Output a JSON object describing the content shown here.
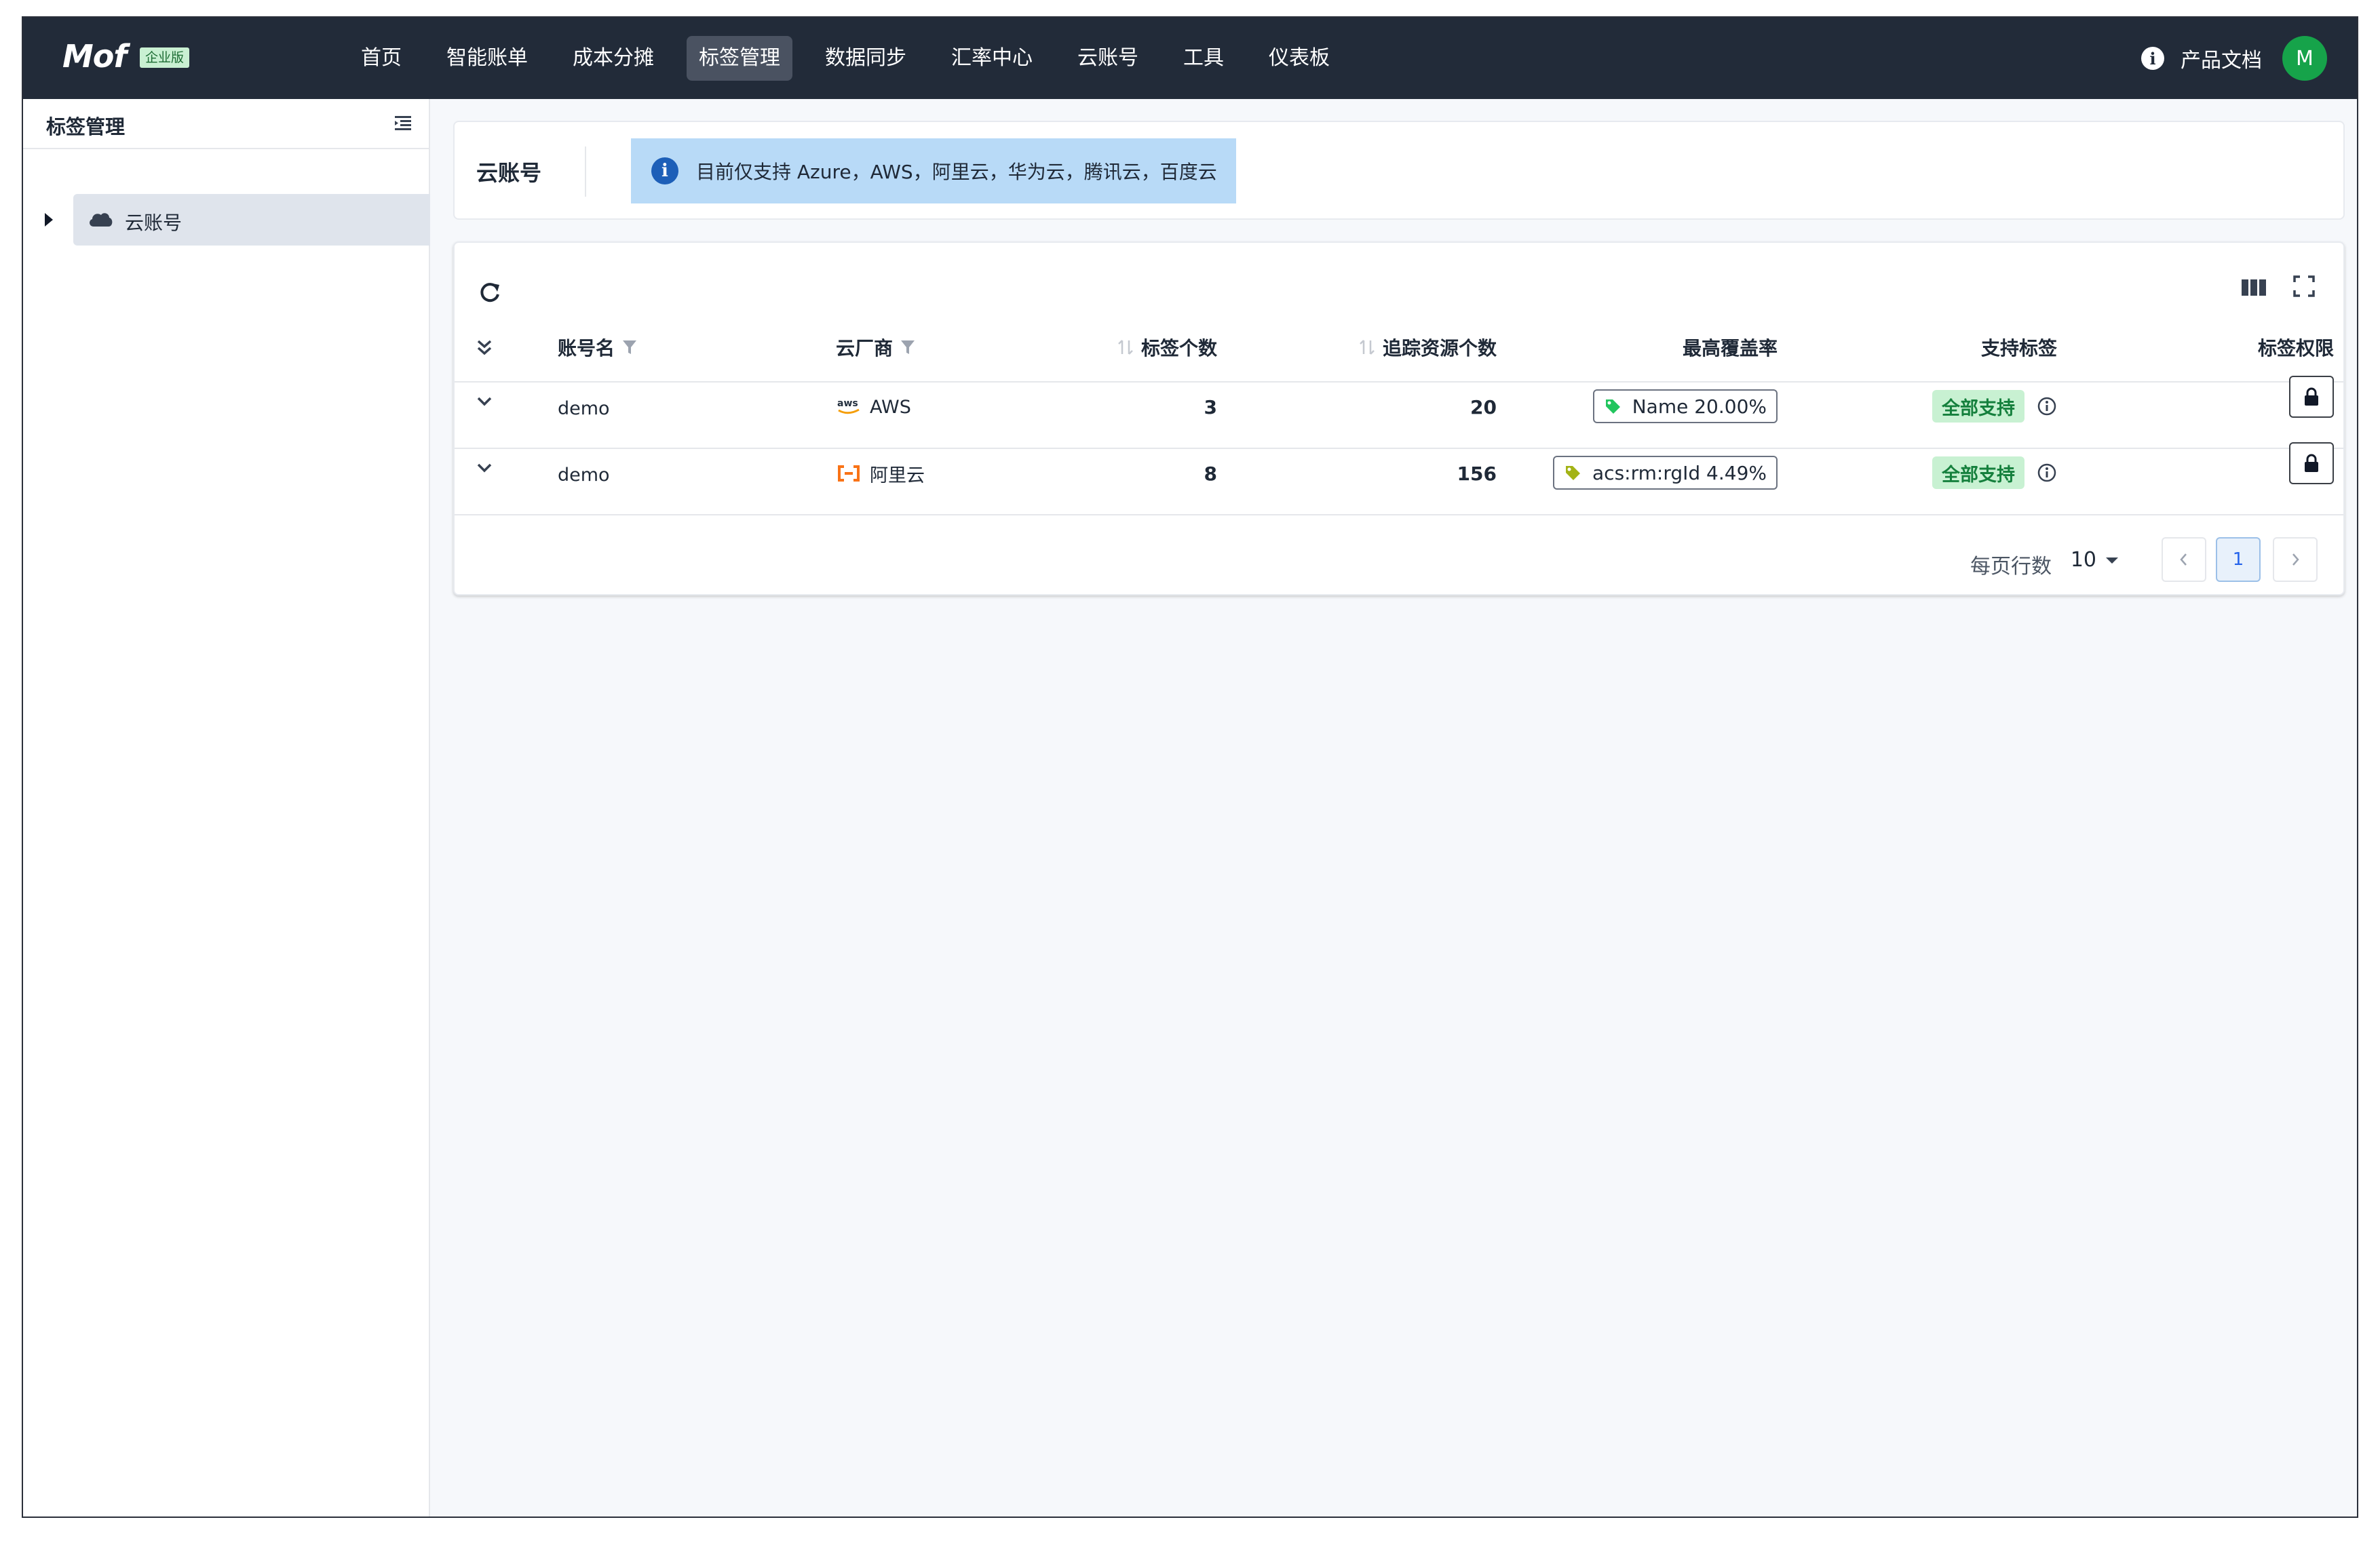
{
  "app": {
    "logo": "Mof",
    "edition": "企业版"
  },
  "nav": {
    "items": [
      "首页",
      "智能账单",
      "成本分摊",
      "标签管理",
      "数据同步",
      "汇率中心",
      "云账号",
      "工具",
      "仪表板"
    ],
    "active": "标签管理",
    "docs_label": "产品文档",
    "avatar_initial": "M",
    "avatar_color": "#16a34a"
  },
  "sidebar": {
    "title": "标签管理",
    "tree_item_label": "云账号"
  },
  "main": {
    "page_title": "云账号",
    "notice": "目前仅支持 Azure，AWS，阿里云，华为云，腾讯云，百度云"
  },
  "table": {
    "columns": [
      "账号名",
      "云厂商",
      "标签个数",
      "追踪资源个数",
      "最高覆盖率",
      "支持标签",
      "标签权限"
    ],
    "rows": [
      {
        "account": "demo",
        "vendor": "AWS",
        "vendor_icon": "aws-logo-icon",
        "tag_count": "3",
        "tracked": "20",
        "coverage": "Name 20.00%",
        "support": "全部支持"
      },
      {
        "account": "demo",
        "vendor": "阿里云",
        "vendor_icon": "aliyun-logo-icon",
        "tag_count": "8",
        "tracked": "156",
        "coverage": "acs:rm:rgId 4.49%",
        "support": "全部支持"
      }
    ]
  },
  "pagination": {
    "rows_per_page_label": "每页行数",
    "rows_per_page": "10",
    "current_page": "1"
  },
  "colors": {
    "topbar": "#222b39",
    "notice_bg": "#b8daf7",
    "support_badge_bg": "#c8f1d2",
    "tag_icon_green": "#22c55e",
    "tag_icon_olive": "#a3b316",
    "aws_orange": "#f59e0b",
    "aliyun_orange": "#f97316"
  }
}
